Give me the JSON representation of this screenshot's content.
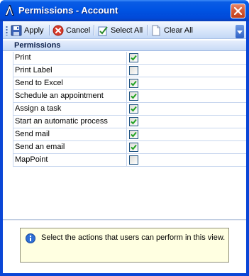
{
  "window": {
    "title": "Permissions - Account"
  },
  "toolbar": {
    "apply_label": "Apply",
    "cancel_label": "Cancel",
    "select_all_label": "Select All",
    "clear_all_label": "Clear All"
  },
  "grid": {
    "header": "Permissions",
    "rows": [
      {
        "label": "Print",
        "checked": true
      },
      {
        "label": "Print Label",
        "checked": false
      },
      {
        "label": "Send to Excel",
        "checked": true
      },
      {
        "label": "Schedule an appointment",
        "checked": true
      },
      {
        "label": "Assign a task",
        "checked": true
      },
      {
        "label": "Start an automatic process",
        "checked": true
      },
      {
        "label": "Send mail",
        "checked": true
      },
      {
        "label": "Send an email",
        "checked": true
      },
      {
        "label": "MapPoint",
        "checked": false
      }
    ]
  },
  "info": {
    "text": "Select the actions that users can perform in this view.",
    "icon": "info-icon"
  },
  "colors": {
    "titlebar": "#0054e3",
    "check": "#21a121",
    "info_background": "#ffffe1"
  }
}
